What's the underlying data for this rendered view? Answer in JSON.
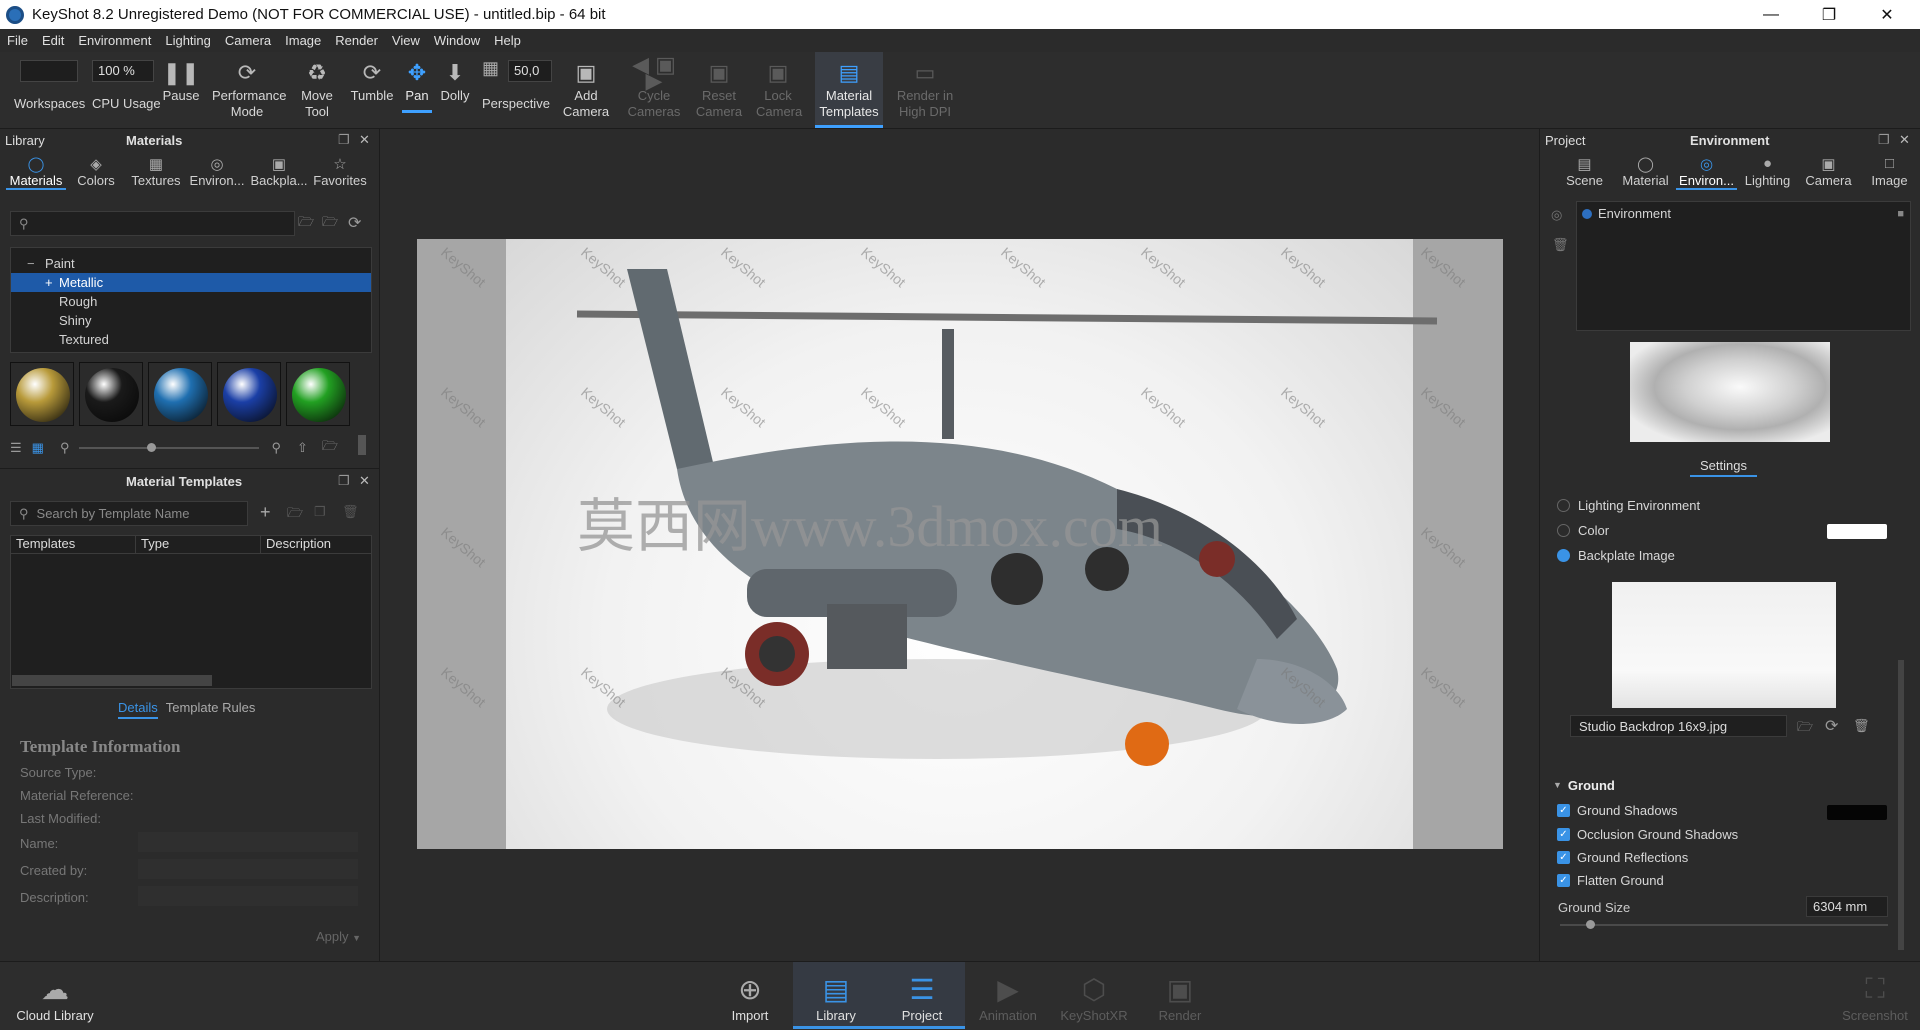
{
  "window": {
    "title": "KeyShot 8.2 Unregistered Demo (NOT FOR COMMERCIAL USE) - untitled.bip  - 64 bit"
  },
  "menu": [
    "File",
    "Edit",
    "Environment",
    "Lighting",
    "Camera",
    "Image",
    "Render",
    "View",
    "Window",
    "Help"
  ],
  "toolbar": {
    "workspaces": "Workspaces",
    "cpu_field": "100 %",
    "cpu": "CPU Usage",
    "pause": "Pause",
    "performance": "Performance Mode",
    "move": "Move Tool",
    "tumble": "Tumble",
    "pan": "Pan",
    "dolly": "Dolly",
    "persp_field": "50,0",
    "perspective": "Perspective",
    "add_camera": "Add Camera",
    "cycle": "Cycle Cameras",
    "reset": "Reset Camera",
    "lock": "Lock Camera",
    "material_templates": "Material Templates",
    "render_hidpi": "Render in High DPI"
  },
  "library": {
    "header": "Library",
    "title": "Materials",
    "tabs": [
      "Materials",
      "Colors",
      "Textures",
      "Environ...",
      "Backpla...",
      "Favorites"
    ],
    "tree": [
      {
        "label": "Paint",
        "indent": 0,
        "prefix": "−"
      },
      {
        "label": "Metallic",
        "indent": 1,
        "prefix": "+",
        "selected": true
      },
      {
        "label": "Rough",
        "indent": 1,
        "prefix": ""
      },
      {
        "label": "Shiny",
        "indent": 1,
        "prefix": ""
      },
      {
        "label": "Textured",
        "indent": 1,
        "prefix": ""
      }
    ],
    "swatch_colors": [
      "#b89a3a",
      "#1a1a1a",
      "#1f6fb0",
      "#1b3fa6",
      "#22a022"
    ]
  },
  "templates": {
    "title": "Material Templates",
    "search_placeholder": "Search by Template Name",
    "columns": [
      "Templates",
      "Type",
      "Description"
    ],
    "subtabs": [
      "Details",
      "Template Rules"
    ],
    "info_title": "Template Information",
    "fields": [
      "Source Type:",
      "Material Reference:",
      "Last Modified:",
      "Name:",
      "Created by:",
      "Description:"
    ],
    "apply": "Apply"
  },
  "viewport": {
    "watermark_text": "KeyShot",
    "overlay_text": "莫西网www.3dmox.com"
  },
  "project": {
    "header": "Project",
    "title": "Environment",
    "tabs": [
      "Scene",
      "Material",
      "Environ...",
      "Lighting",
      "Camera",
      "Image"
    ],
    "env_item": "Environment",
    "settings_tab": "Settings",
    "options": [
      {
        "label": "Lighting Environment",
        "on": false
      },
      {
        "label": "Color",
        "on": false
      },
      {
        "label": "Backplate Image",
        "on": true
      }
    ],
    "backplate_file": "Studio Backdrop 16x9.jpg",
    "ground": {
      "title": "Ground",
      "items": [
        "Ground Shadows",
        "Occlusion Ground Shadows",
        "Ground Reflections",
        "Flatten Ground"
      ],
      "size_label": "Ground Size",
      "size_value": "6304 mm"
    }
  },
  "bottom": {
    "cloud": "Cloud Library",
    "import": "Import",
    "library": "Library",
    "project": "Project",
    "animation": "Animation",
    "keyshotxr": "KeyShotXR",
    "render": "Render",
    "screenshot": "Screenshot"
  }
}
